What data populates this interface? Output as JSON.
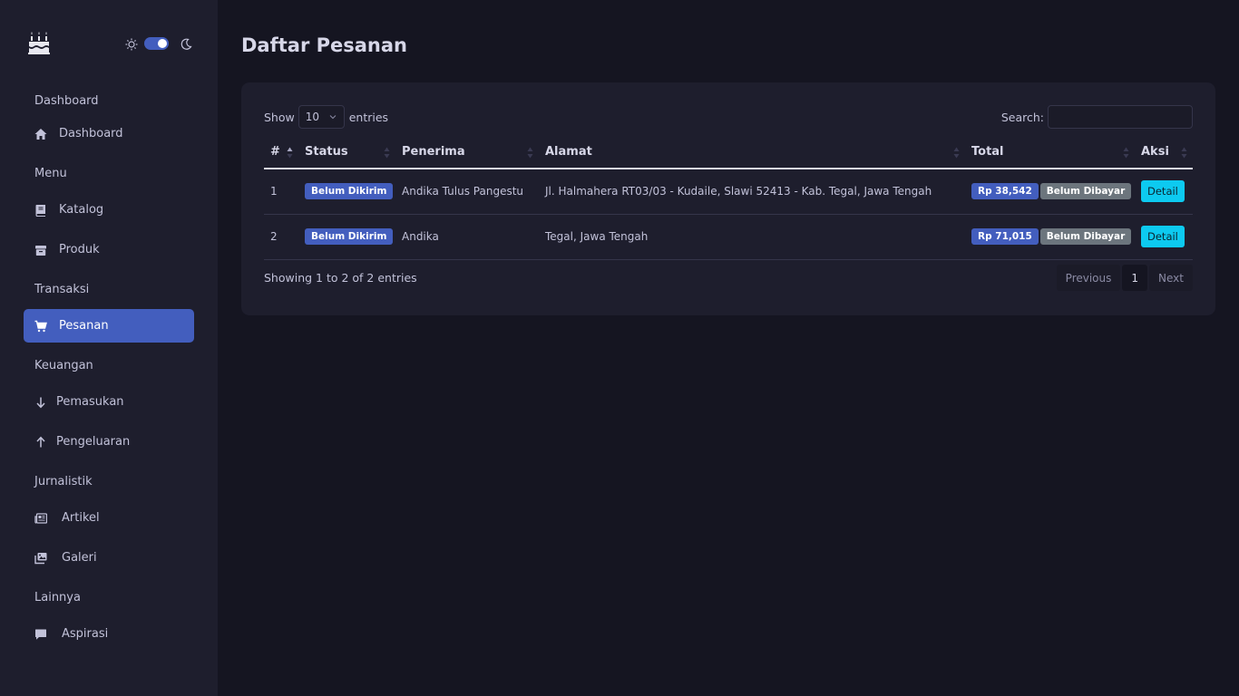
{
  "sidebar": {
    "sections": [
      {
        "title": "Dashboard",
        "items": [
          {
            "label": "Dashboard",
            "icon": "house-icon"
          }
        ]
      },
      {
        "title": "Menu",
        "items": [
          {
            "label": "Katalog",
            "icon": "book-icon"
          },
          {
            "label": "Produk",
            "icon": "box-icon"
          }
        ]
      },
      {
        "title": "Transaksi",
        "items": [
          {
            "label": "Pesanan",
            "icon": "cart-icon"
          }
        ]
      },
      {
        "title": "Keuangan",
        "items": [
          {
            "label": "Pemasukan",
            "icon": "arrow-down-icon"
          },
          {
            "label": "Pengeluaran",
            "icon": "arrow-up-icon"
          }
        ]
      },
      {
        "title": "Jurnalistik",
        "items": [
          {
            "label": "Artikel",
            "icon": "newspaper-icon"
          },
          {
            "label": "Galeri",
            "icon": "images-icon"
          }
        ]
      },
      {
        "title": "Lainnya",
        "items": [
          {
            "label": "Aspirasi",
            "icon": "chat-icon"
          }
        ]
      }
    ],
    "active_item": "Pesanan"
  },
  "page": {
    "title": "Daftar Pesanan"
  },
  "datatable": {
    "show_label": "Show",
    "length_value": "10",
    "entries_label": "entries",
    "search_label": "Search:",
    "search_value": "",
    "columns": [
      "#",
      "Status",
      "Penerima",
      "Alamat",
      "Total",
      "Aksi"
    ],
    "rows": [
      {
        "no": "1",
        "status": "Belum Dikirim",
        "penerima": "Andika Tulus Pangestu",
        "alamat": "Jl. Halmahera RT03/03 - Kudaile, Slawi 52413 - Kab. Tegal, Jawa Tengah",
        "total": "Rp 38,542",
        "payment": "Belum Dibayar",
        "action": "Detail"
      },
      {
        "no": "2",
        "status": "Belum Dikirim",
        "penerima": "Andika",
        "alamat": "Tegal, Jawa Tengah",
        "total": "Rp 71,015",
        "payment": "Belum Dibayar",
        "action": "Detail"
      }
    ],
    "info": "Showing 1 to 2 of 2 entries",
    "pagination": {
      "previous": "Previous",
      "current": "1",
      "next": "Next"
    }
  },
  "colors": {
    "accent": "#435ebe",
    "info_button": "#0dcaf0",
    "secondary_badge": "#6c757d"
  }
}
